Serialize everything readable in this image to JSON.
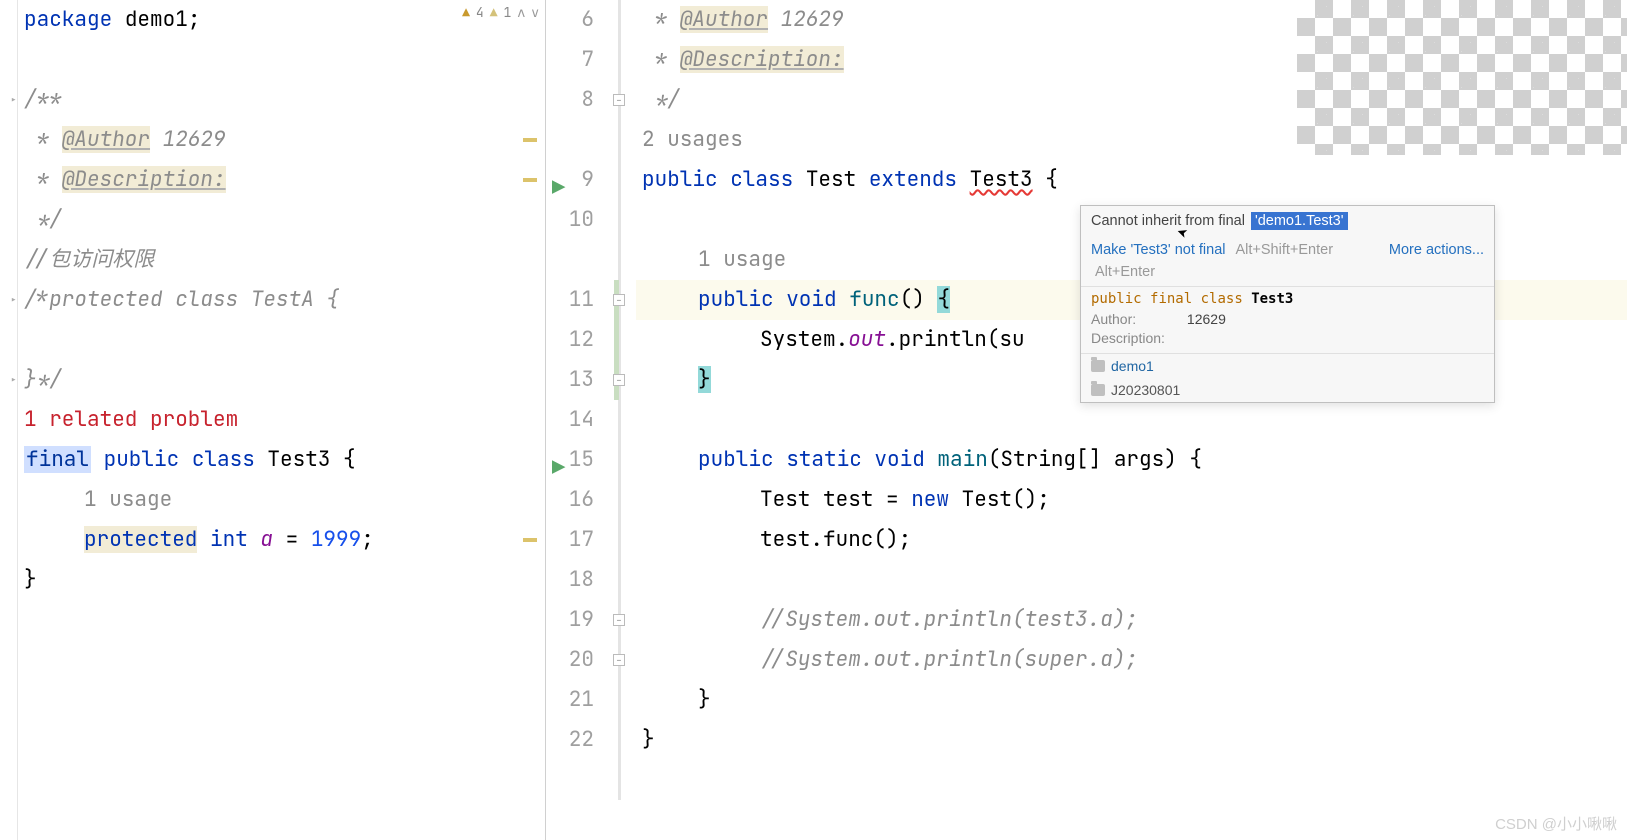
{
  "inspections": {
    "warn_count": "4",
    "weak_count": "1"
  },
  "left": {
    "l1": {
      "pkg": "package",
      "name": "demo1",
      "semi": ";"
    },
    "doc_open": "/**",
    "doc_author_tag": "@Author",
    "doc_author_val": " 12629",
    "doc_desc_tag": "@Description:",
    "doc_close": " */",
    "cmt_access": "//包访问权限",
    "cmt_protected": "/*protected class TestA {",
    "cmt_close": "}*/",
    "related": "1 related problem",
    "final_kw": "final",
    "pub": " public ",
    "cls": "class ",
    "clsname": "Test3 ",
    "brace": "{",
    "usage1": "1 usage",
    "prot": "protected",
    "int": " int ",
    "a": "a",
    "eq": " = ",
    "val": "1999",
    "semi2": ";",
    "close": "}"
  },
  "right": {
    "ln": {
      "n6": "6",
      "n7": "7",
      "n8": "8",
      "n9": "9",
      "n10": "10",
      "n11": "11",
      "n12": "12",
      "n13": "13",
      "n14": "14",
      "n15": "15",
      "n16": "16",
      "n17": "17",
      "n18": "18",
      "n19": "19",
      "n20": "20",
      "n21": "21",
      "n22": "22"
    },
    "doc_author_pre": " * ",
    "doc_author_tag": "@Author",
    "doc_author_val": " 12629",
    "doc_desc_pre": " * ",
    "doc_desc_tag": "@Description:",
    "doc_close": " */",
    "usages2": "2 usages",
    "pub": "public",
    "cls": " class ",
    "tname": "Test ",
    "ext": "extends ",
    "tsup": "Test3",
    "brace": " {",
    "usage1": "1 usage",
    "pubv": "public",
    "voidk": " void ",
    "fname": "func",
    "paren": "() ",
    "obrace": "{",
    "sysout_a": "System.",
    "sysout_b": "out",
    "sysout_c": ".println(su",
    "cbrace": "}",
    "mainline": {
      "pub": "public",
      "stat": " static ",
      "void": "void ",
      "main": "main",
      "args": "(String[] args) {"
    },
    "body1": {
      "a": "Test test = ",
      "new": "new",
      "b": " Test();"
    },
    "body2": "test.func();",
    "cmt1": "//System.out.println(test3.a);",
    "cmt2": "//System.out.println(super.a);",
    "cbrace2": "}",
    "cbrace3": "}"
  },
  "tooltip": {
    "err_prefix": "Cannot inherit from final ",
    "err_ref": "'demo1.Test3'",
    "fix": "Make 'Test3' not final",
    "fix_sc": "Alt+Shift+Enter",
    "more": "More actions...",
    "more_sc": "Alt+Enter",
    "sig": {
      "pub": "public",
      "fin": "final",
      "cls": "class",
      "name": " Test3"
    },
    "author_k": "Author:",
    "author_v": "12629",
    "desc_k": "Description:",
    "pkg": "demo1",
    "module": "J20230801"
  },
  "watermark": "CSDN @小小啾啾"
}
